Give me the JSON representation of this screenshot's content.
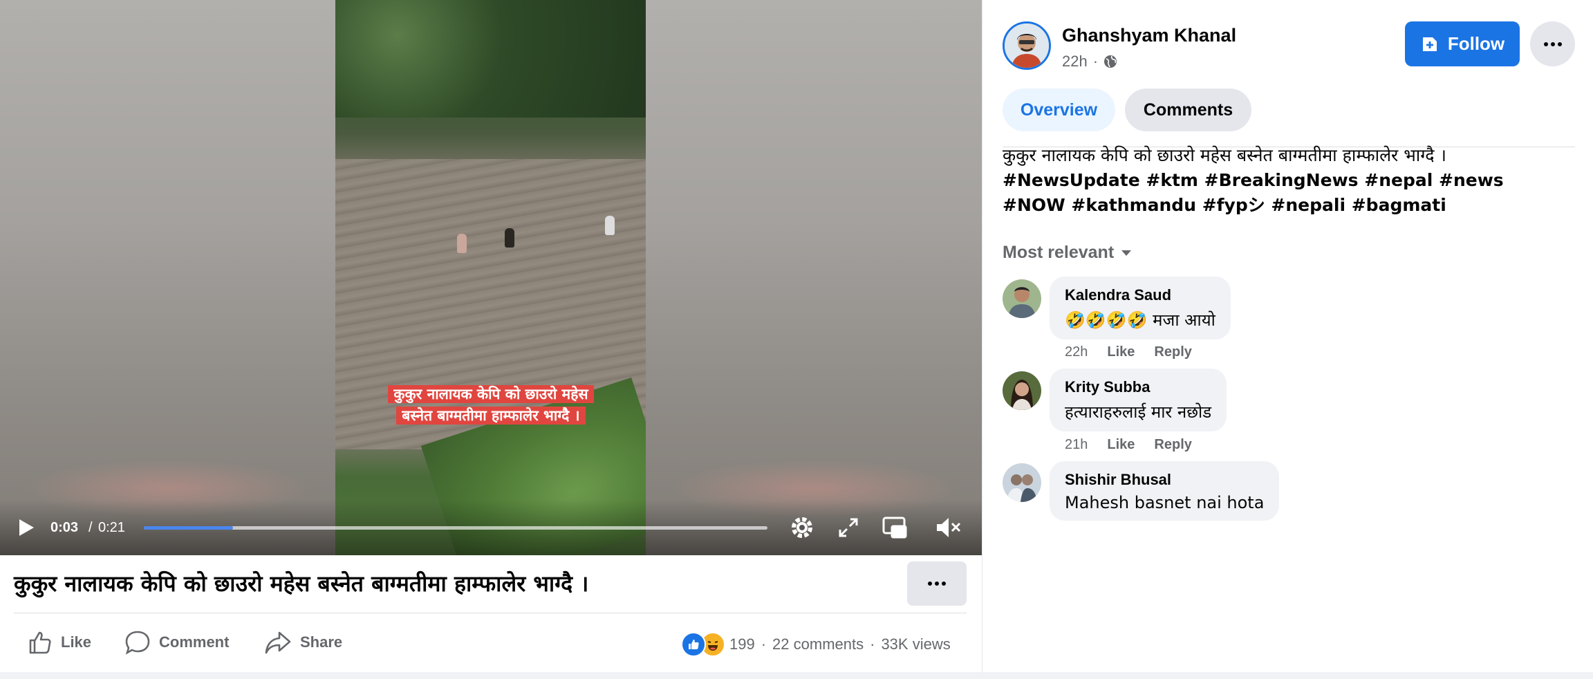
{
  "video": {
    "subtitle_line1": "कुकुर नालायक केपि को छाउरो महेस",
    "subtitle_line2": "बस्नेत बाग्मतीमा हाम्फालेर भाग्दै ।",
    "time_current": "0:03",
    "time_separator": "/",
    "time_total": "0:21",
    "progress_fraction": 0.143,
    "icons": [
      "play-icon",
      "gear-icon",
      "expand-icon",
      "picture-in-picture-icon",
      "mute-icon"
    ]
  },
  "post": {
    "title": "कुकुर नालायक केपि को छाउरो महेस बस्नेत बाग्मतीमा हाम्फालेर भाग्दै ।",
    "actions": {
      "like": "Like",
      "comment": "Comment",
      "share": "Share"
    },
    "stats": {
      "reaction_count": "199",
      "comments": "22 comments",
      "views": "33K views",
      "separator": "·"
    }
  },
  "author": {
    "name": "Ghanshyam Khanal",
    "time": "22h",
    "meta_separator": "·",
    "audience_icon": "globe-icon",
    "follow_label": "Follow"
  },
  "tabs": [
    {
      "label": "Overview",
      "active": true
    },
    {
      "label": "Comments",
      "active": false
    }
  ],
  "caption": {
    "text": "कुकुर नालायक केपि को छाउरो महेस बस्नेत बाग्मतीमा हाम्फालेर भाग्दै ।",
    "hashtags": "#NewsUpdate #ktm #BreakingNews #nepal #news #NOW #kathmandu #fypシ #nepali #bagmati"
  },
  "comments_section": {
    "sort_label": "Most relevant",
    "comments": [
      {
        "author": "Kalendra Saud",
        "text": "🤣🤣🤣🤣 मजा आयो",
        "time": "22h",
        "like": "Like",
        "reply": "Reply"
      },
      {
        "author": "Krity Subba",
        "text": "हत्याराहरुलाई मार नछोड",
        "time": "21h",
        "like": "Like",
        "reply": "Reply"
      },
      {
        "author": "Shishir Bhusal",
        "text": "Mahesh basnet nai hota"
      }
    ]
  },
  "colors": {
    "brand_blue": "#1b74e4",
    "progress": "#4a86ee",
    "subtitle_bg": "#e0463f",
    "secondary_text": "#65676b",
    "bubble_bg": "#f0f2f5"
  }
}
